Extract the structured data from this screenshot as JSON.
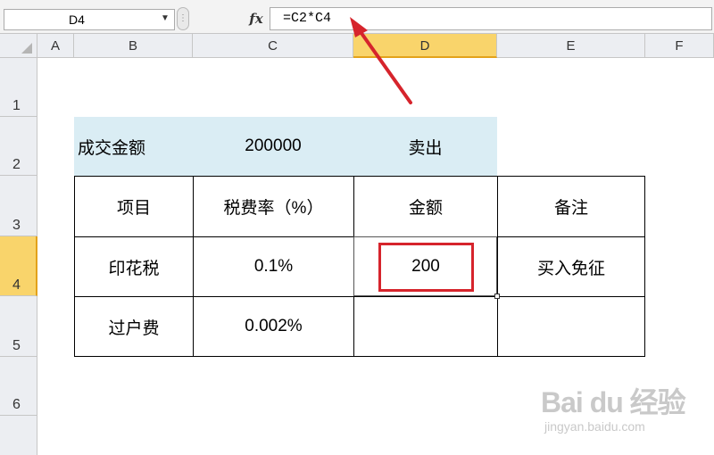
{
  "formula_bar": {
    "name_box": "D4",
    "fx_icon": "fx",
    "formula": "=C2*C4"
  },
  "columns": [
    "A",
    "B",
    "C",
    "D",
    "E",
    "F"
  ],
  "rows": [
    "1",
    "2",
    "3",
    "4",
    "5",
    "6"
  ],
  "active_cell": {
    "column": "D",
    "row": "4"
  },
  "table": {
    "row2": {
      "b": "成交金额",
      "c": "200000",
      "d": "卖出"
    },
    "row3": {
      "b": "项目",
      "c": "税费率（%）",
      "d": "金额",
      "e": "备注"
    },
    "row4": {
      "b": "印花税",
      "c": "0.1%",
      "d": "200",
      "e": "买入免征"
    },
    "row5": {
      "b": "过户费",
      "c": "0.002%",
      "d": "",
      "e": ""
    }
  },
  "annotation": {
    "color": "#d6242c",
    "description_target": "formula"
  },
  "watermark": {
    "main": "Bai du 经验",
    "sub": "jingyan.baidu.com"
  },
  "colors": {
    "header_band": "#daedf4",
    "active_header": "#f9d46b",
    "annotation": "#d6242c"
  }
}
